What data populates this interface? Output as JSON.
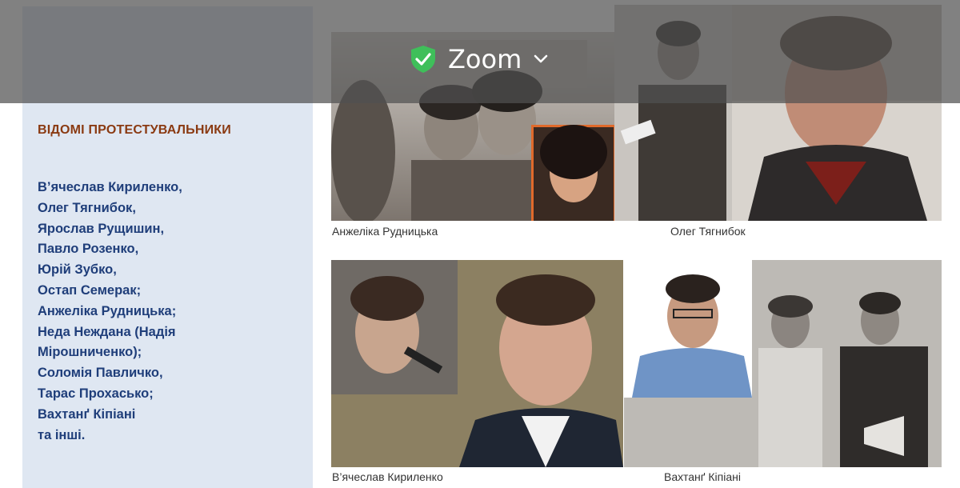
{
  "slide": {
    "section_title": "ВІДОМІ ПРОТЕСТУВАЛЬНИКИ",
    "names": [
      "В’ячеслав Кириленко,",
      "Олег Тягнибок,",
      "Ярослав Рущишин,",
      "Павло Розенко,",
      "Юрій Зубко,",
      "Остап Семерак;",
      "Анжеліка Рудницька;",
      "Неда Неждана (Надія",
      "Мірошниченко);",
      "Соломія Павличко,",
      "Тарас Прохасько;",
      "Вахтанґ Кіпіані",
      "та інші."
    ]
  },
  "photos": {
    "rudnytska_caption": "Анжеліка Рудницька",
    "tiahnybok_caption": "Олег Тягнибок",
    "kyrylenko_caption": "В’ячеслав Кириленко",
    "kipiani_caption": "Вахтанґ Кіпіані"
  },
  "zoom": {
    "label": "Zoom",
    "shield_icon": "shield-check-icon",
    "chevron_icon": "chevron-down-icon",
    "shield_color": "#3fbf5a"
  }
}
